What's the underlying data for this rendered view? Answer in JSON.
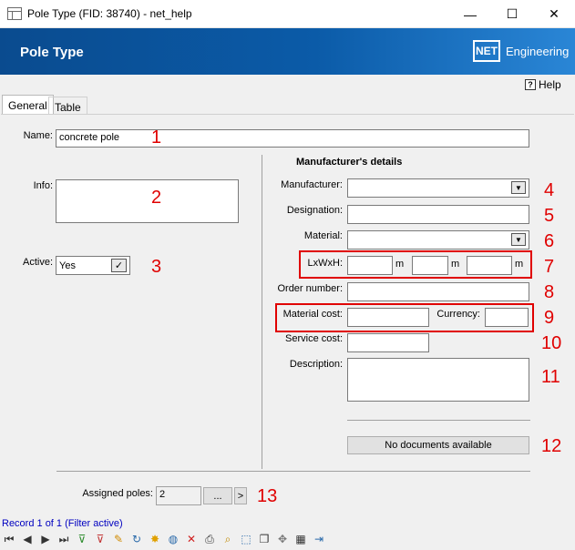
{
  "window": {
    "title": "Pole Type (FID: 38740) - net_help",
    "minimize": "—",
    "maximize": "☐",
    "close": "✕"
  },
  "header": {
    "title": "Pole Type",
    "logo": "NET",
    "brand": "Engineering"
  },
  "help": {
    "icon": "?",
    "label": "Help"
  },
  "tabs": [
    {
      "label": "General",
      "active": true
    },
    {
      "label": "Table",
      "active": false
    }
  ],
  "form": {
    "name_label": "Name:",
    "name_value": "concrete pole",
    "info_label": "Info:",
    "info_value": "",
    "active_label": "Active:",
    "active_value": "Yes",
    "active_check": "✓"
  },
  "manufacturer": {
    "section_title": "Manufacturer's details",
    "manufacturer_label": "Manufacturer:",
    "designation_label": "Designation:",
    "material_label": "Material:",
    "lwh_label": "LxWxH:",
    "unit": "m",
    "order_label": "Order number:",
    "material_cost_label": "Material cost:",
    "currency_label": "Currency:",
    "service_cost_label": "Service cost:",
    "description_label": "Description:",
    "documents": "No documents available"
  },
  "assigned": {
    "label": "Assigned poles:",
    "value": "2",
    "ellipsis": "...",
    "next": ">"
  },
  "annotations": [
    "1",
    "2",
    "3",
    "4",
    "5",
    "6",
    "7",
    "8",
    "9",
    "10",
    "11",
    "12",
    "13"
  ],
  "status": "Record 1 of 1 (Filter active)",
  "toolbar_icons": [
    "first-record-icon",
    "prev-record-icon",
    "next-record-icon",
    "last-record-icon",
    "add-filter-icon",
    "remove-filter-icon",
    "edit-icon",
    "refresh-icon",
    "new-icon",
    "globe-icon",
    "delete-icon",
    "print-icon",
    "zoom-icon",
    "select-icon",
    "copy-icon",
    "move-icon",
    "table-icon",
    "exit-icon"
  ],
  "colors": {
    "accent": "#0b5ba8",
    "annotation": "#e00000"
  }
}
